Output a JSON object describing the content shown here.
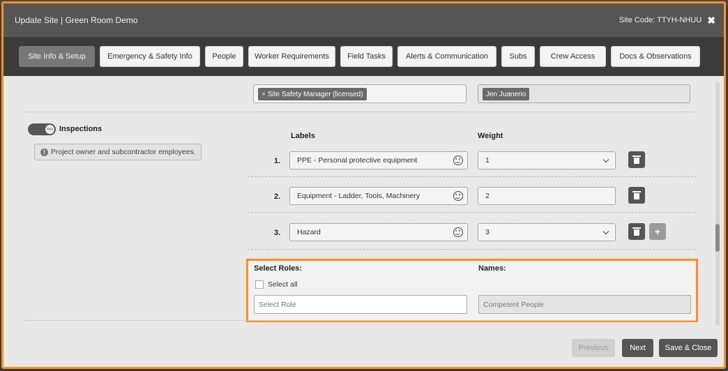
{
  "header": {
    "title": "Update Site | Green Room Demo",
    "site_code": "Site Code: TTYH-NHUU"
  },
  "tabs": [
    {
      "label": "Site Info & Setup",
      "active": true
    },
    {
      "label": "Emergency & Safety Info",
      "active": false
    },
    {
      "label": "People",
      "active": false
    },
    {
      "label": "Worker Requirements",
      "active": false
    },
    {
      "label": "Field Tasks",
      "active": false
    },
    {
      "label": "Alerts & Communication",
      "active": false
    },
    {
      "label": "Subs",
      "active": false
    },
    {
      "label": "Crew Access",
      "active": false
    },
    {
      "label": "Docs & Observations",
      "active": false
    }
  ],
  "top_row": {
    "role_chip": "Site Safety Manager (licensed)",
    "name_chip": "Jen Juanerio"
  },
  "inspections": {
    "toggle_state": "Yes",
    "title": "Inspections",
    "info": "Project owner and subcontractor employees.",
    "labels_header": "Labels",
    "weight_header": "Weight",
    "rows": [
      {
        "num": "1.",
        "label": "PPE - Personal protective equipment",
        "weight": "1"
      },
      {
        "num": "2.",
        "label": "Equipment - Ladder, Tools, Machinery",
        "weight": "2"
      },
      {
        "num": "3.",
        "label": "Hazard",
        "weight": "3"
      }
    ]
  },
  "roles_section": {
    "select_roles_label": "Select Roles:",
    "names_label": "Names:",
    "select_all": "Select all",
    "role_placeholder": "Select Role",
    "names_placeholder": "Competent People"
  },
  "footer": {
    "previous": "Previous",
    "next": "Next",
    "save_close": "Save & Close"
  },
  "colors": {
    "accent": "#f7931e",
    "header_bg": "#555555",
    "tabbar_bg": "#3b3b3b"
  }
}
